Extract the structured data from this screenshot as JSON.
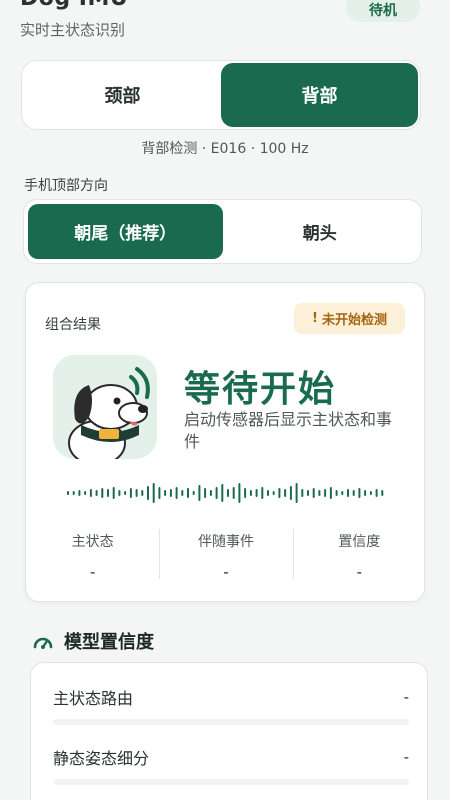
{
  "header": {
    "title": "Dog IMU",
    "subtitle": "实时主状态识别",
    "status": "待机"
  },
  "placement": {
    "options": [
      "颈部",
      "背部"
    ],
    "selected": 1
  },
  "mode_info": "背部检测 · E016 · 100 Hz",
  "orientation": {
    "label": "手机顶部方向",
    "options": [
      "朝尾（推荐）",
      "朝头"
    ],
    "selected": 0
  },
  "result": {
    "label": "组合结果",
    "badge_icon": "!",
    "badge_text": "未开始检测",
    "headline": "等待开始",
    "description": "启动传感器后显示主状态和事件",
    "stats": [
      {
        "label": "主状态",
        "value": "-"
      },
      {
        "label": "伴随事件",
        "value": "-"
      },
      {
        "label": "置信度",
        "value": "-"
      }
    ]
  },
  "confidence": {
    "title": "模型置信度",
    "icon": "gauge-icon",
    "rows": [
      {
        "label": "主状态路由",
        "value": "-"
      },
      {
        "label": "静态姿态细分",
        "value": "-"
      }
    ]
  },
  "colors": {
    "primary": "#1a6a50",
    "warn_bg": "#fdf0d8",
    "warn_text": "#a5640f",
    "background": "#f3f6f4"
  }
}
